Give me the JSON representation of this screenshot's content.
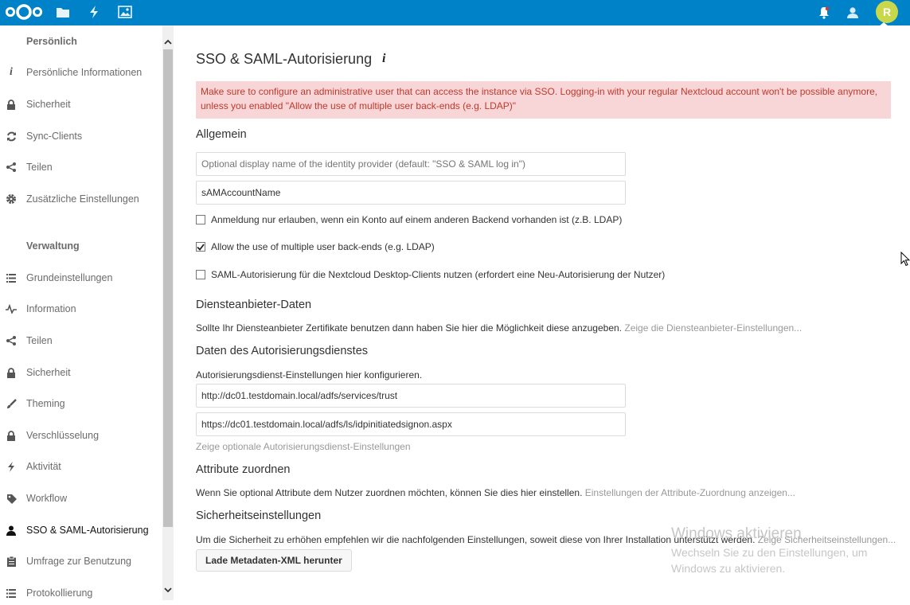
{
  "header": {
    "apps": [
      {
        "icon": "files-icon"
      },
      {
        "icon": "activity-icon"
      },
      {
        "icon": "gallery-icon"
      }
    ],
    "avatar_initial": "R",
    "color": "#0082c9"
  },
  "sidebar": {
    "personal_title": "Persönlich",
    "personal_items": [
      {
        "label": "Persönliche Informationen",
        "icon": "info-icon"
      },
      {
        "label": "Sicherheit",
        "icon": "lock-icon"
      },
      {
        "label": "Sync-Clients",
        "icon": "sync-icon"
      },
      {
        "label": "Teilen",
        "icon": "share-icon"
      },
      {
        "label": "Zusätzliche Einstellungen",
        "icon": "gear-icon"
      }
    ],
    "admin_title": "Verwaltung",
    "admin_items": [
      {
        "label": "Grundeinstellungen",
        "icon": "list-icon"
      },
      {
        "label": "Information",
        "icon": "pulse-icon"
      },
      {
        "label": "Teilen",
        "icon": "share-icon"
      },
      {
        "label": "Sicherheit",
        "icon": "lock-icon"
      },
      {
        "label": "Theming",
        "icon": "brush-icon"
      },
      {
        "label": "Verschlüsselung",
        "icon": "lock-icon"
      },
      {
        "label": "Aktivität",
        "icon": "activity-icon"
      },
      {
        "label": "Workflow",
        "icon": "tag-icon"
      },
      {
        "label": "SSO & SAML-Autorisierung",
        "icon": "user-icon",
        "active": true
      },
      {
        "label": "Umfrage zur Benutzung",
        "icon": "clipboard-icon"
      },
      {
        "label": "Protokollierung",
        "icon": "list-icon"
      }
    ]
  },
  "main": {
    "title": "SSO & SAML-Autorisierung",
    "warning": "Make sure to configure an administrative user that can access the instance via SSO. Logging-in with your regular Nextcloud account won't be possible anymore, unless you enabled \"Allow the use of multiple user back-ends (e.g. LDAP)\"",
    "general_title": "Allgemein",
    "display_name_placeholder": "Optional display name of the identity provider (default: \"SSO & SAML log in\")",
    "uid_value": "sAMAccountName",
    "checkbox1_label": "Anmeldung nur erlauben, wenn ein Konto auf einem anderen Backend vorhanden ist (z.B. LDAP)",
    "checkbox1_checked": false,
    "checkbox2_label": "Allow the use of multiple user back-ends (e.g. LDAP)",
    "checkbox2_checked": true,
    "checkbox3_label": "SAML-Autorisierung für die Nextcloud Desktop-Clients nutzen (erfordert eine Neu-Autorisierung der Nutzer)",
    "checkbox3_checked": false,
    "sp_title": "Diensteanbieter-Daten",
    "sp_text": "Sollte Ihr Diensteanbieter Zertifikate benutzen dann haben Sie hier die Möglichkeit diese anzugeben.",
    "sp_link": "Zeige die Diensteanbieter-Einstellungen...",
    "idp_title": "Daten des Autorisierungsdienstes",
    "idp_text": "Autorisierungsdienst-Einstellungen hier konfigurieren.",
    "idp_entity": "http://dc01.testdomain.local/adfs/services/trust",
    "idp_sso_url": "https://dc01.testdomain.local/adfs/ls/idpinitiatedsignon.aspx",
    "idp_optional_link": "Zeige optionale Autorisierungsdienst-Einstellungen",
    "attr_title": "Attribute zuordnen",
    "attr_text": "Wenn Sie optional Attribute dem Nutzer zuordnen möchten, können Sie dies hier einstellen.",
    "attr_link": "Einstellungen der Attribute-Zuordnung anzeigen...",
    "sec_title": "Sicherheitseinstellungen",
    "sec_text": "Um die Sicherheit zu erhöhen empfehlen wir die nachfolgenden Einstellungen, soweit diese von Ihrer Installation unterstützt werden.",
    "sec_link": "Zeige Sicherheitseinstellungen...",
    "download_button": "Lade Metadaten-XML herunter"
  },
  "watermark": {
    "line1": "Windows aktivieren",
    "line2": "Wechseln Sie zu den Einstellungen, um",
    "line3": "Windows zu aktivieren."
  }
}
